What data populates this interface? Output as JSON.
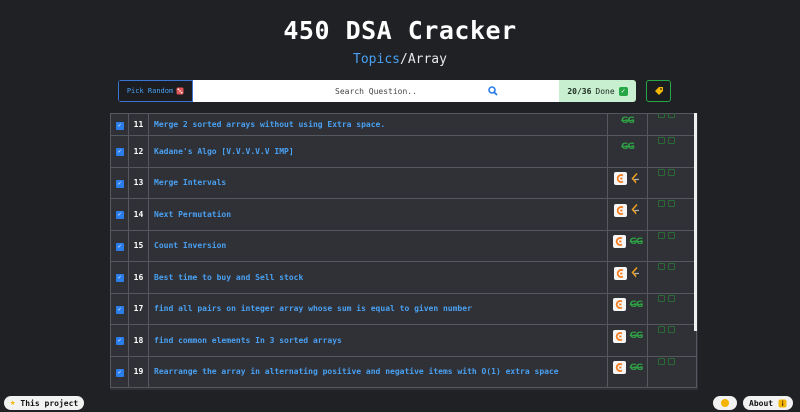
{
  "header": {
    "title": "450 DSA Cracker",
    "breadcrumb_link": "Topics",
    "breadcrumb_sep": "/",
    "breadcrumb_current": "Array"
  },
  "toolbar": {
    "pick_random_label": "Pick Random",
    "search_placeholder": "Search Question..",
    "done_count": "20/36",
    "done_label": "Done"
  },
  "questions": [
    {
      "num": "11",
      "title": "Merge 2 sorted arrays without using Extra space.",
      "links": [
        "gfg"
      ]
    },
    {
      "num": "12",
      "title": "Kadane's Algo [V.V.V.V.V IMP]",
      "links": [
        "gfg"
      ]
    },
    {
      "num": "13",
      "title": "Merge Intervals",
      "links": [
        "codingninjas",
        "leetcode"
      ]
    },
    {
      "num": "14",
      "title": "Next Permutation",
      "links": [
        "codingninjas",
        "leetcode"
      ]
    },
    {
      "num": "15",
      "title": "Count Inversion",
      "links": [
        "codingninjas",
        "gfg"
      ]
    },
    {
      "num": "16",
      "title": "Best time to buy and Sell stock",
      "links": [
        "codingninjas",
        "leetcode"
      ]
    },
    {
      "num": "17",
      "title": "find all pairs on integer array whose sum is equal to given number",
      "links": [
        "codingninjas",
        "gfg"
      ]
    },
    {
      "num": "18",
      "title": "find common elements In 3 sorted arrays",
      "links": [
        "codingninjas",
        "gfg"
      ]
    },
    {
      "num": "19",
      "title": "Rearrange the array in alternating positive and negative items with O(1) extra space",
      "links": [
        "codingninjas",
        "gfg"
      ]
    }
  ],
  "footer": {
    "this_project_label": "This project",
    "about_label": "About"
  },
  "colors": {
    "background": "#1f2125",
    "accent_blue": "#4aa0f2",
    "done_bg": "#c8efcf",
    "gfg_green": "#2f9e44"
  }
}
